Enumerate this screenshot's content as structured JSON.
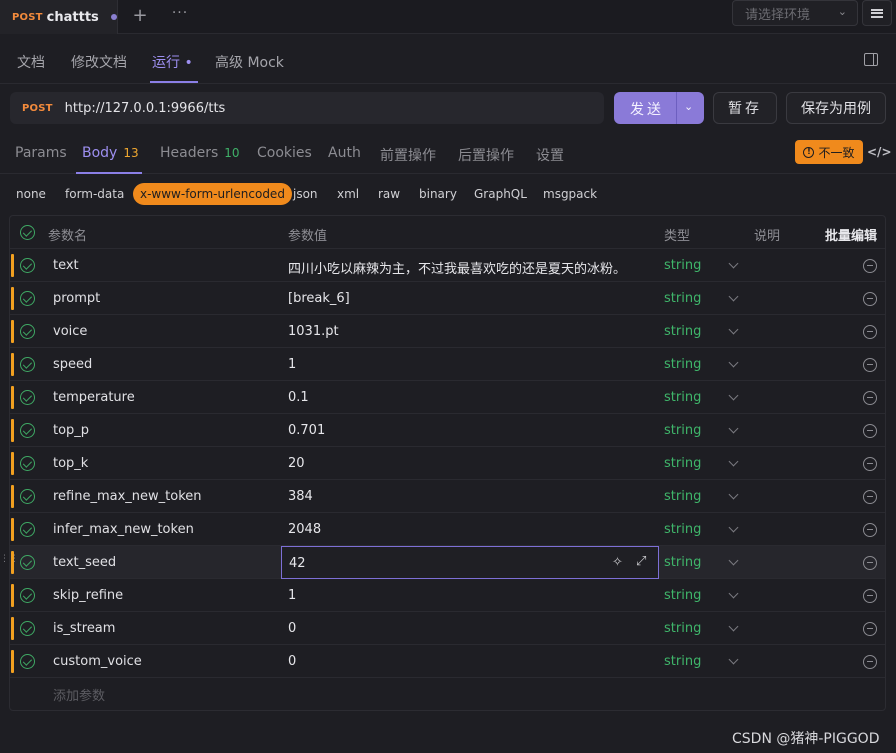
{
  "top_tab": {
    "method": "POST",
    "name": "chattts"
  },
  "env_select": {
    "placeholder": "请选择环境"
  },
  "nav": {
    "items": [
      "文档",
      "修改文档",
      "运行 •",
      "高级 Mock"
    ],
    "active": "运行 •"
  },
  "request": {
    "method": "POST",
    "url": "http://127.0.0.1:9966/tts"
  },
  "buttons": {
    "send": "发送",
    "save": "暂存",
    "save_case": "保存为用例"
  },
  "param_tabs": {
    "params": "Params",
    "body": "Body",
    "body_count": "13",
    "headers": "Headers",
    "headers_count": "10",
    "cookies": "Cookies",
    "auth": "Auth",
    "pre": "前置操作",
    "post": "后置操作",
    "settings": "设置"
  },
  "mismatch_badge": "不一致",
  "body_types": [
    "none",
    "form-data",
    "x-www-form-urlencoded",
    "json",
    "xml",
    "raw",
    "binary",
    "GraphQL",
    "msgpack"
  ],
  "active_body_type": "x-www-form-urlencoded",
  "table": {
    "headers": {
      "name": "参数名",
      "value": "参数值",
      "type": "类型",
      "desc": "说明",
      "bulk_edit": "批量编辑"
    },
    "rows": [
      {
        "name": "text",
        "value": "四川小吃以麻辣为主，不过我最喜欢吃的还是夏天的冰粉。",
        "type": "string"
      },
      {
        "name": "prompt",
        "value": "[break_6]",
        "type": "string"
      },
      {
        "name": "voice",
        "value": "1031.pt",
        "type": "string"
      },
      {
        "name": "speed",
        "value": "1",
        "type": "string"
      },
      {
        "name": "temperature",
        "value": "0.1",
        "type": "string"
      },
      {
        "name": "top_p",
        "value": "0.701",
        "type": "string"
      },
      {
        "name": "top_k",
        "value": "20",
        "type": "string"
      },
      {
        "name": "refine_max_new_token",
        "value": "384",
        "type": "string"
      },
      {
        "name": "infer_max_new_token",
        "value": "2048",
        "type": "string"
      },
      {
        "name": "text_seed",
        "value": "42",
        "type": "string"
      },
      {
        "name": "skip_refine",
        "value": "1",
        "type": "string"
      },
      {
        "name": "is_stream",
        "value": "0",
        "type": "string"
      },
      {
        "name": "custom_voice",
        "value": "0",
        "type": "string"
      }
    ],
    "add_placeholder": "添加参数"
  },
  "watermark": "CSDN @猪神-PIGGOD",
  "colors": {
    "accent": "#8b7fe6",
    "orange": "#f08a1c",
    "string_green": "#3fb56a"
  }
}
